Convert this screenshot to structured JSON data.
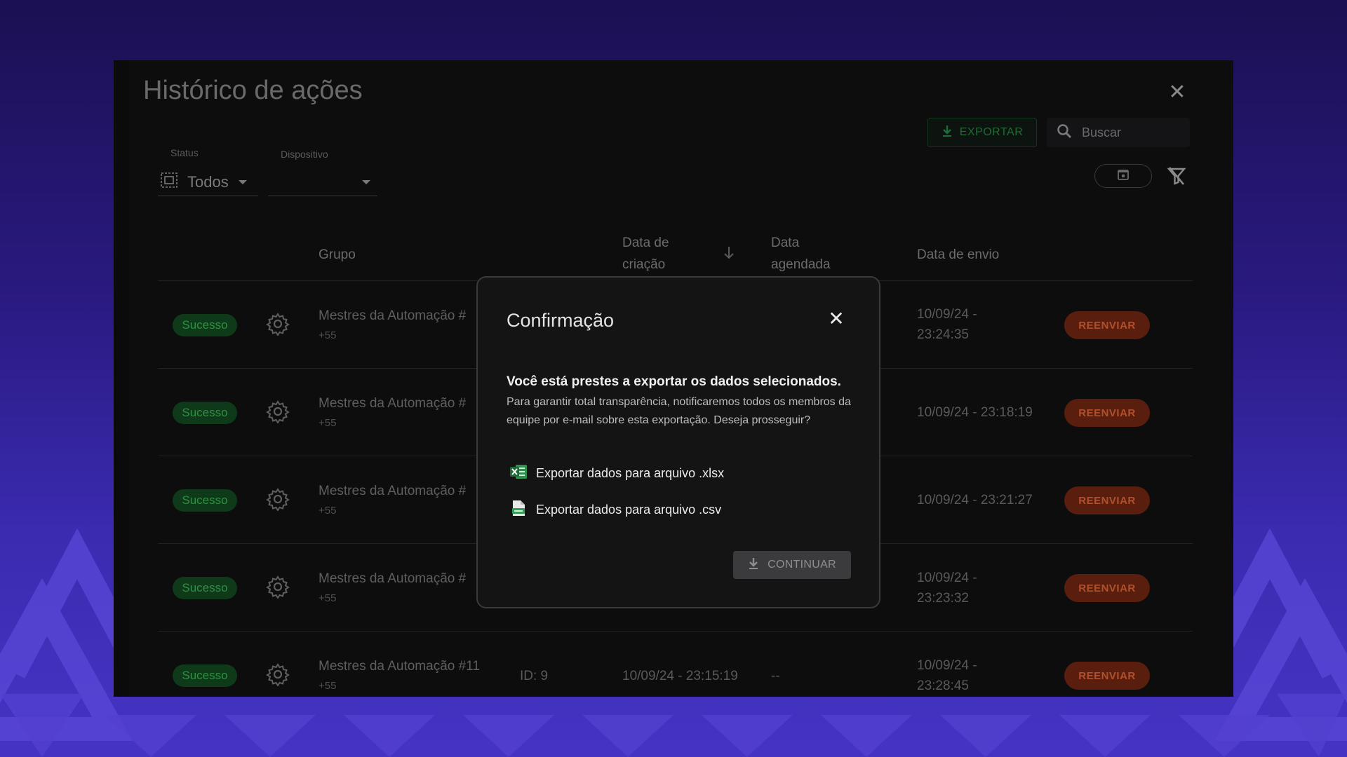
{
  "title": "Histórico de ações",
  "toolbar": {
    "export_label": "EXPORTAR",
    "search_placeholder": "Buscar"
  },
  "filters": {
    "status_label": "Status",
    "status_value": "Todos",
    "device_label": "Dispositivo",
    "device_value": ""
  },
  "table": {
    "headers": {
      "group": "Grupo",
      "created_line1": "Data de",
      "created_line2": "criação",
      "scheduled_line1": "Data",
      "scheduled_line2": "agendada",
      "sent": "Data de envio"
    },
    "rows": [
      {
        "status": "Sucesso",
        "group": "Mestres da Automação #",
        "sub": "+55",
        "sent_line1": "10/09/24 -",
        "sent_line2": "23:24:35",
        "action": "REENVIAR"
      },
      {
        "status": "Sucesso",
        "group": "Mestres da Automação #",
        "sub": "+55",
        "sent_line1": "10/09/24 - 23:18:19",
        "sent_line2": "",
        "action": "REENVIAR"
      },
      {
        "status": "Sucesso",
        "group": "Mestres da Automação #",
        "sub": "+55",
        "sent_line1": "10/09/24 - 23:21:27",
        "sent_line2": "",
        "action": "REENVIAR"
      },
      {
        "status": "Sucesso",
        "group": "Mestres da Automação #",
        "sub": "+55",
        "sent_line1": "10/09/24 -",
        "sent_line2": "23:23:32",
        "action": "REENVIAR"
      },
      {
        "status": "Sucesso",
        "group": "Mestres da Automação #11",
        "sub": "+55",
        "id": "ID: 9",
        "created": "10/09/24 - 23:15:19",
        "scheduled": "--",
        "sent_line1": "10/09/24 -",
        "sent_line2": "23:28:45",
        "action": "REENVIAR"
      }
    ]
  },
  "modal": {
    "title": "Confirmação",
    "headline": "Você está prestes a exportar os dados selecionados.",
    "body": "Para garantir total transparência, notificaremos todos os membros da equipe por e-mail sobre esta exportação. Deseja prosseguir?",
    "option_xlsx": "Exportar dados para arquivo .xlsx",
    "option_csv": "Exportar dados para arquivo .csv",
    "continue_label": "CONTINUAR"
  },
  "colors": {
    "success": "#2f8f45",
    "resend": "#b0502c",
    "accent_export": "#1e6b35"
  }
}
